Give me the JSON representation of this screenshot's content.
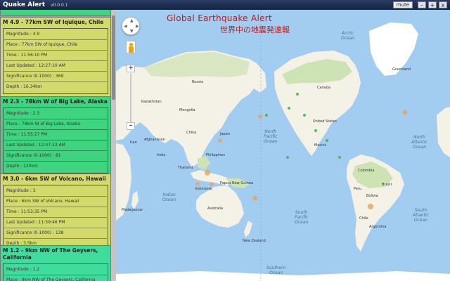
{
  "window": {
    "title": "Quake Alert",
    "version": "v0.0.0.1",
    "mute_label": "mute",
    "minimize_glyph": "–",
    "maximize_glyph": "+",
    "close_glyph": "x"
  },
  "colors": {
    "card_yellow": "#d3da6c",
    "card_green": "#3fd47f",
    "card_green_teal": "#40dc9e",
    "map_water": "#a3cdf0",
    "map_land": "#f4f1e6",
    "map_forest": "#cde3b3",
    "alert_red": "#c0161b",
    "quake_marker": "#e6a35a"
  },
  "overlay": {
    "title": "Global Earthquake Alert",
    "subtitle": "世界中の地震発速報"
  },
  "map_controls": {
    "pan_icon": "pan-arrows-icon",
    "zoom_in": "+",
    "zoom_out": "–"
  },
  "quakes": [
    {
      "title": "M 4.9 - 77km SW of Iquique, Chile",
      "color": "#d3da6c",
      "rows": [
        "Magnitude : 4.9",
        "Place : 77km SW of Iquique, Chile",
        "Time : 11:56:10 PM",
        "Last Updated : 12:27:10 AM",
        "Significance (0-1000) : 369",
        "Depth : 16.34km"
      ]
    },
    {
      "title": "M 2.3 - 78km W of Big Lake, Alaska",
      "color": "#3fd47f",
      "rows": [
        "Magnitude : 2.3",
        "Place : 78km W of Big Lake, Alaska",
        "Time : 11:55:27 PM",
        "Last Updated : 12:07:13 AM",
        "Significance (0-1000) : 81",
        "Depth : 120km"
      ]
    },
    {
      "title": "M 3.0 - 6km SW of Volcano, Hawaii",
      "color": "#d3da6c",
      "rows": [
        "Magnitude : 3",
        "Place : 6km SW of Volcano, Hawaii",
        "Time : 11:53:35 PM",
        "Last Updated : 11:59:46 PM",
        "Significance (0-1000) : 138",
        "Depth : 3.5km"
      ]
    },
    {
      "title": "M 1.2 - 9km NW of The Geysers, California",
      "color": "#40dc9e",
      "rows": [
        "Magnitude : 1.2",
        "Place : 9km NW of The Geysers, California"
      ]
    }
  ],
  "map_labels": {
    "greenland": "Greenland",
    "north_pacific": "North\nPacific\nOcean",
    "north_atlantic": "North\nAtlantic\nOcean",
    "south_pacific": "South\nPacific\nOcean",
    "south_atlantic": "South\nAtlantic\nOcean",
    "indian": "Indian\nOcean",
    "southern": "Southern\nOcean",
    "arctic": "Arctic\nOcean",
    "china": "China",
    "india": "India",
    "russia": "Russia",
    "kazakhstan": "Kazakhstan",
    "mongolia": "Mongolia",
    "afghanistan": "Afghanistan",
    "japan": "Japan",
    "australia": "Australia",
    "indonesia": "Indonesia",
    "madagascar": "Madagascar",
    "canada": "Canada",
    "united_states": "United States",
    "mexico": "Mexico",
    "brazil": "Brazil",
    "peru": "Peru",
    "argentina": "Argentina",
    "bolivia": "Bolivia",
    "colombia": "Colombia",
    "chile": "Chile",
    "papua": "Papua New Guinea",
    "new_zealand": "New Zealand",
    "thailand": "Thailand",
    "iran": "Iran",
    "philippines": "Philippines"
  }
}
